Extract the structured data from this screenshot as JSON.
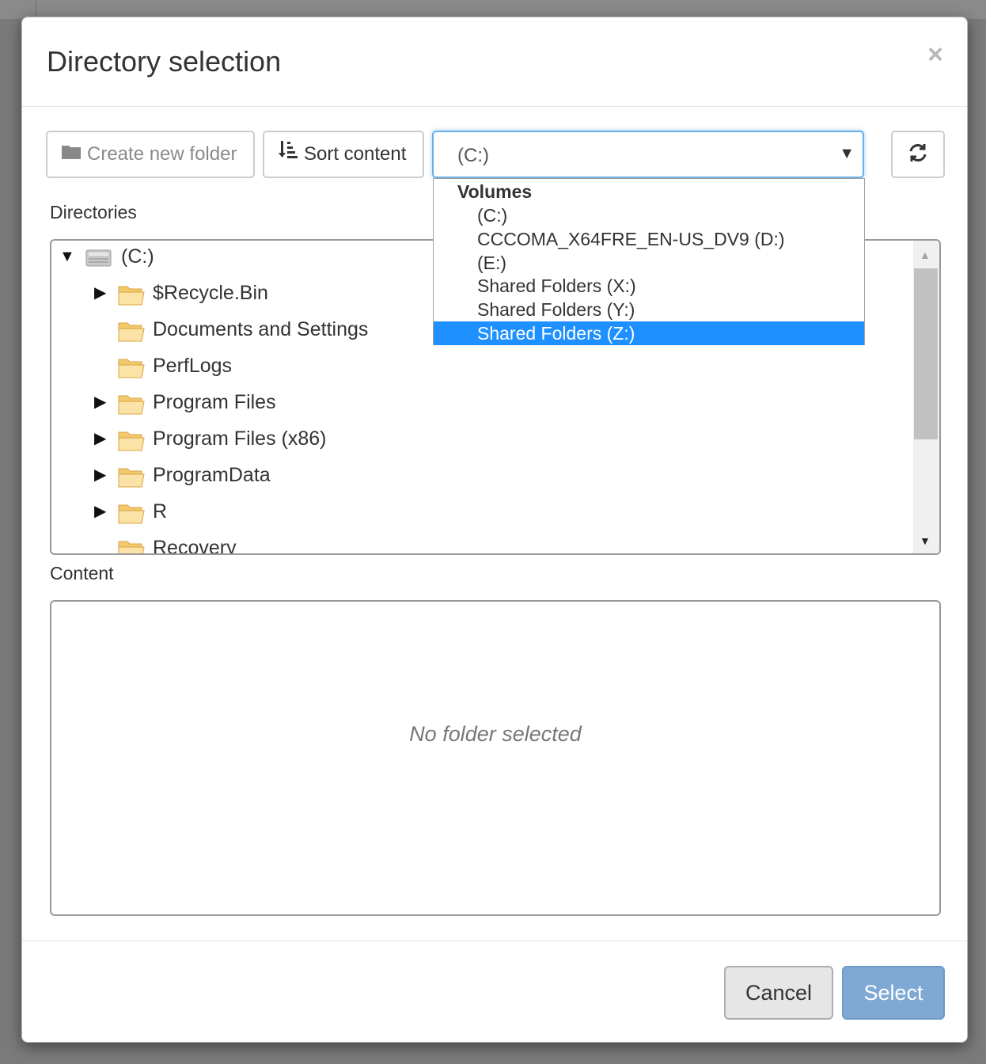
{
  "dialog": {
    "title": "Directory selection",
    "close_label": "×"
  },
  "toolbar": {
    "create_folder_label": "Create new folder",
    "sort_label": "Sort content",
    "volume_value": "(C:)",
    "select_arrow": "▼",
    "refresh_icon": "refresh-icon"
  },
  "dropdown": {
    "group_label": "Volumes",
    "options": [
      {
        "label": "(C:)",
        "selected": false
      },
      {
        "label": "CCCOMA_X64FRE_EN-US_DV9 (D:)",
        "selected": false
      },
      {
        "label": "(E:)",
        "selected": false
      },
      {
        "label": "Shared Folders (X:)",
        "selected": false
      },
      {
        "label": "Shared Folders (Y:)",
        "selected": false
      },
      {
        "label": "Shared Folders (Z:)",
        "selected": true
      }
    ]
  },
  "directories": {
    "label": "Directories",
    "root": {
      "name": "(C:)",
      "expanded": true,
      "icon": "drive-icon"
    },
    "items": [
      {
        "name": "$Recycle.Bin",
        "expandable": true
      },
      {
        "name": "Documents and Settings",
        "expandable": false
      },
      {
        "name": "PerfLogs",
        "expandable": false
      },
      {
        "name": "Program Files",
        "expandable": true
      },
      {
        "name": "Program Files (x86)",
        "expandable": true
      },
      {
        "name": "ProgramData",
        "expandable": true
      },
      {
        "name": "R",
        "expandable": true
      },
      {
        "name": "Recovery",
        "expandable": false
      }
    ]
  },
  "content": {
    "label": "Content",
    "empty_text": "No folder selected"
  },
  "footer": {
    "cancel_label": "Cancel",
    "select_label": "Select"
  },
  "colors": {
    "selected_option": "#1e90ff",
    "select_button": "#7fa9d4",
    "folder": "#f6c96a",
    "focus_border": "#66afe9"
  }
}
